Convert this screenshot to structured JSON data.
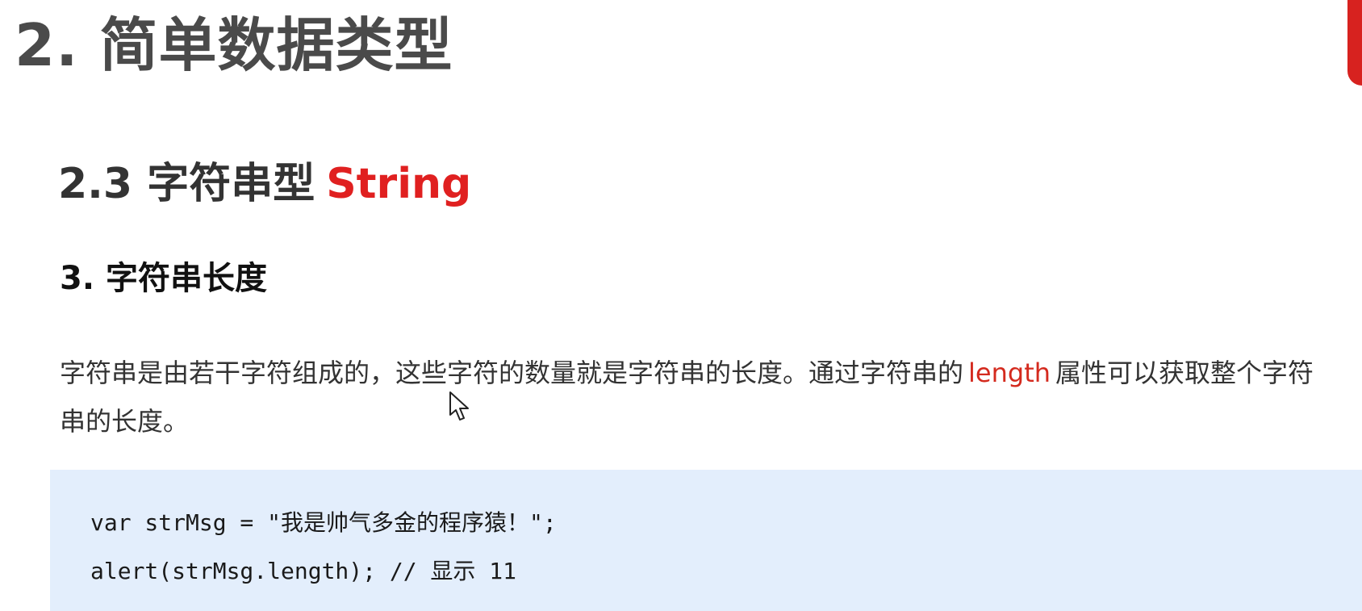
{
  "page": {
    "title": "2. 简单数据类型"
  },
  "section": {
    "title": "2.3 字符串型",
    "accent": "String"
  },
  "subsection": {
    "title": "3. 字符串长度"
  },
  "paragraph": {
    "line1_before": "字符串是由若干字符组成的，这些字符的数量就是字符串的长度。通过字符串的",
    "keyword": "length",
    "line1_after": "属性可以获取整个字符",
    "line2": "串的长度。"
  },
  "code": {
    "lines": [
      "var strMsg = \"我是帅气多金的程序猿！\";",
      "alert(strMsg.length); // 显示 11"
    ]
  },
  "colors": {
    "accent_red": "#e02020",
    "code_background": "#e3eefc",
    "logo_red": "#d7221f"
  },
  "icons": {
    "cursor": "mouse-pointer-icon",
    "logo": "brand-logo-icon"
  }
}
